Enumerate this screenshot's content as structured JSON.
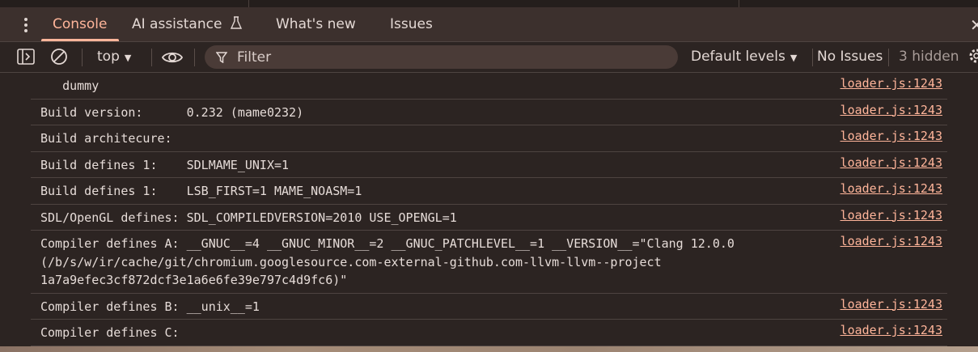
{
  "tabs": [
    {
      "label": "Console"
    },
    {
      "label": "AI assistance"
    },
    {
      "label": "What's new"
    },
    {
      "label": "Issues"
    }
  ],
  "toolbar": {
    "context": "top",
    "filter_placeholder": "Filter",
    "levels": "Default levels",
    "issues": "No Issues",
    "hidden": "3 hidden"
  },
  "colors": {
    "accent": "#ffb59a",
    "background": "#2c2422",
    "tabbar": "#3c302d"
  },
  "console": {
    "rows": [
      {
        "message": "   dummy",
        "source": "loader.js:1243"
      },
      {
        "message": "Build version:      0.232 (mame0232)",
        "source": "loader.js:1243"
      },
      {
        "message": "Build architecure:",
        "source": "loader.js:1243"
      },
      {
        "message": "Build defines 1:    SDLMAME_UNIX=1",
        "source": "loader.js:1243"
      },
      {
        "message": "Build defines 1:    LSB_FIRST=1 MAME_NOASM=1",
        "source": "loader.js:1243"
      },
      {
        "message": "SDL/OpenGL defines: SDL_COMPILEDVERSION=2010 USE_OPENGL=1",
        "source": "loader.js:1243"
      },
      {
        "message": "Compiler defines A: __GNUC__=4 __GNUC_MINOR__=2 __GNUC_PATCHLEVEL__=1 __VERSION__=\"Clang 12.0.0\n(/b/s/w/ir/cache/git/chromium.googlesource.com-external-github.com-llvm-llvm--project\n1a7a9efec3cf872dcf3e1a6e6fe39e797c4d9fc6)\"",
        "source": "loader.js:1243"
      },
      {
        "message": "Compiler defines B: __unix__=1",
        "source": "loader.js:1243"
      },
      {
        "message": "Compiler defines C:",
        "source": "loader.js:1243"
      }
    ]
  }
}
